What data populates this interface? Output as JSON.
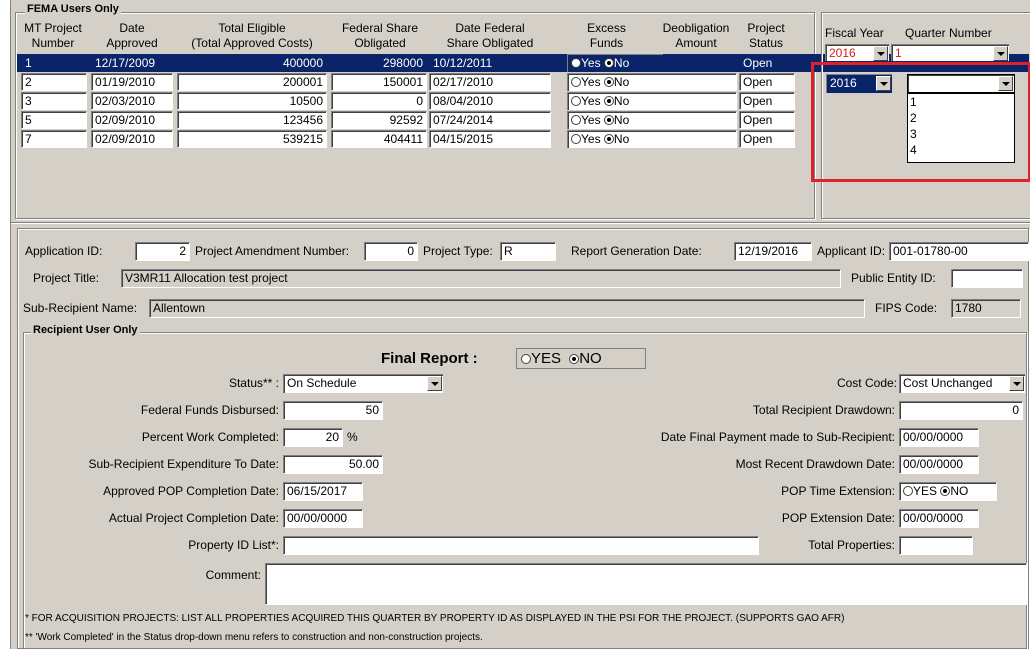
{
  "fema": {
    "group_title": "FEMA Users Only",
    "columns": {
      "mt_project_number": [
        "MT Project",
        "Number"
      ],
      "date_approved": [
        "Date",
        "Approved"
      ],
      "total_eligible": [
        "Total Eligible",
        "(Total Approved Costs)"
      ],
      "federal_share_obligated": [
        "Federal Share",
        "Obligated"
      ],
      "date_federal_share_obligated": [
        "Date Federal",
        "Share Obligated"
      ],
      "excess_funds": [
        "Excess",
        "Funds"
      ],
      "deobligation_amount": [
        "Deobligation",
        "Amount"
      ],
      "project_status": [
        "Project",
        "Status"
      ]
    },
    "rows": [
      {
        "num": "1",
        "date": "12/17/2009",
        "total": "400000",
        "fed": "298000",
        "fed_date": "10/12/2011",
        "excess": "No",
        "deob": "",
        "status": "Open"
      },
      {
        "num": "2",
        "date": "01/19/2010",
        "total": "200001",
        "fed": "150001",
        "fed_date": "02/17/2010",
        "excess": "No",
        "deob": "",
        "status": "Open"
      },
      {
        "num": "3",
        "date": "02/03/2010",
        "total": "10500",
        "fed": "0",
        "fed_date": "08/04/2010",
        "excess": "No",
        "deob": "",
        "status": "Open"
      },
      {
        "num": "5",
        "date": "02/09/2010",
        "total": "123456",
        "fed": "92592",
        "fed_date": "07/24/2014",
        "excess": "No",
        "deob": "",
        "status": "Open"
      },
      {
        "num": "7",
        "date": "02/09/2010",
        "total": "539215",
        "fed": "404411",
        "fed_date": "04/15/2015",
        "excess": "No",
        "deob": "",
        "status": "Open"
      }
    ],
    "radio_yes": "Yes",
    "radio_no": "No"
  },
  "period": {
    "fiscal_year_label": "Fiscal Year",
    "quarter_number_label": "Quarter Number",
    "header_year": "2016",
    "header_quarter": "1",
    "row_year": "2016",
    "row_quarter": "",
    "quarter_options": [
      "1",
      "2",
      "3",
      "4"
    ]
  },
  "project": {
    "application_id_label": "Application ID:",
    "application_id": "2",
    "amendment_label": "Project Amendment Number:",
    "amendment": "0",
    "type_label": "Project Type:",
    "type": "R",
    "report_date_label": "Report Generation Date:",
    "report_date": "12/19/2016",
    "applicant_id_label": "Applicant ID:",
    "applicant_id": "001-01780-00",
    "title_label": "Project Title:",
    "title": "V3MR11 Allocation test project",
    "public_entity_label": "Public Entity ID:",
    "public_entity": "",
    "subrecipient_label": "Sub-Recipient Name:",
    "subrecipient": "Allentown",
    "fips_label": "FIPS Code:",
    "fips": "1780"
  },
  "recipient": {
    "group_title": "Recipient User Only",
    "final_report_label": "Final Report :",
    "final_yes": "YES",
    "final_no": "NO",
    "status_label": "Status** :",
    "status_value": "On Schedule",
    "cost_code_label": "Cost Code:",
    "cost_code_value": "Cost Unchanged",
    "fed_disbursed_label": "Federal Funds Disbursed:",
    "fed_disbursed": "50",
    "total_drawdown_label": "Total Recipient Drawdown:",
    "total_drawdown": "0",
    "pct_label": "Percent Work Completed:",
    "pct": "20",
    "pct_unit": "%",
    "final_payment_label": "Date Final Payment made to Sub-Recipient:",
    "final_payment": "00/00/0000",
    "expenditure_label": "Sub-Recipient Expenditure To Date:",
    "expenditure": "50.00",
    "recent_drawdown_label": "Most Recent Drawdown Date:",
    "recent_drawdown": "00/00/0000",
    "pop_completion_label": "Approved POP Completion Date:",
    "pop_completion": "06/15/2017",
    "pop_ext_label": "POP Time Extension:",
    "pop_ext_yes": "YES",
    "pop_ext_no": "NO",
    "actual_completion_label": "Actual Project Completion Date:",
    "actual_completion": "00/00/0000",
    "pop_ext_date_label": "POP Extension Date:",
    "pop_ext_date": "00/00/0000",
    "property_list_label": "Property ID List*:",
    "property_list": "",
    "total_properties_label": "Total Properties:",
    "total_properties": "",
    "comment_label": "Comment:",
    "comment": ""
  },
  "notes": {
    "note1": "* FOR ACQUISITION PROJECTS: LIST ALL PROPERTIES ACQUIRED THIS QUARTER BY PROPERTY ID AS DISPLAYED IN THE PSI FOR THE PROJECT.  (SUPPORTS GAO AFR)",
    "note2": "** 'Work Completed' in the Status drop-down menu refers to construction and non-construction projects."
  }
}
